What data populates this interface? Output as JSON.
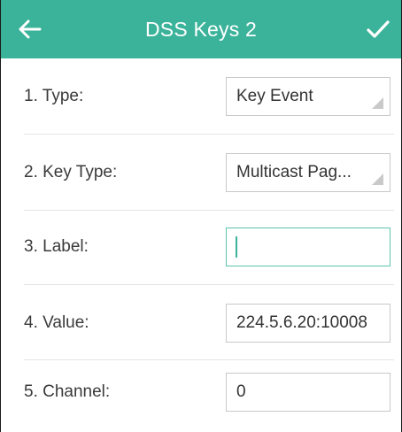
{
  "header": {
    "title": "DSS Keys 2",
    "back_icon": "back-arrow-icon",
    "confirm_icon": "checkmark-icon",
    "color": "#3bb39a"
  },
  "fields": [
    {
      "label": "1. Type:",
      "value": "Key Event",
      "kind": "select"
    },
    {
      "label": "2. Key Type:",
      "value": "Multicast Pag...",
      "kind": "select"
    },
    {
      "label": "3. Label:",
      "value": "",
      "kind": "text",
      "focused": true
    },
    {
      "label": "4. Value:",
      "value": "224.5.6.20:10008",
      "kind": "text"
    },
    {
      "label": "5. Channel:",
      "value": "0",
      "kind": "text"
    }
  ]
}
